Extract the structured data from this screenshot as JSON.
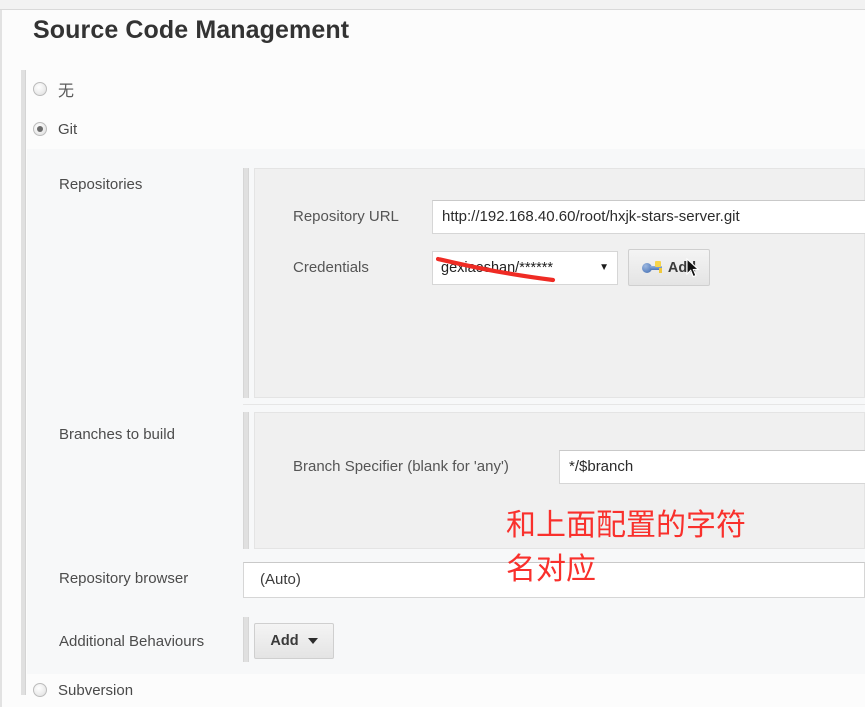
{
  "page": {
    "title": "Source Code Management"
  },
  "scm_options": [
    {
      "label": "无",
      "selected": false,
      "name": "none"
    },
    {
      "label": "Git",
      "selected": true,
      "name": "git"
    },
    {
      "label": "Subversion",
      "selected": false,
      "name": "subversion"
    }
  ],
  "git": {
    "sections": {
      "repositories_label": "Repositories",
      "branches_label": "Branches to build",
      "repository_browser_label": "Repository browser",
      "additional_behaviours_label": "Additional Behaviours"
    },
    "repository": {
      "url_label": "Repository URL",
      "url_value": "http://192.168.40.60/root/hxjk-stars-server.git",
      "credentials_label": "Credentials",
      "credentials_value": "gexiaoshan/******",
      "credentials_arrow": "▼",
      "add_credentials_label": "Add"
    },
    "branches": {
      "specifier_label": "Branch Specifier (blank for 'any')",
      "specifier_value": "*/$branch"
    },
    "repository_browser": {
      "value": "(Auto)"
    },
    "additional_behaviours": {
      "add_label": "Add"
    }
  },
  "annotations": {
    "note_text": "和上面配置的字符\n名对应",
    "note_color": "#f9302c",
    "strikethrough_color": "#ef2b24"
  }
}
